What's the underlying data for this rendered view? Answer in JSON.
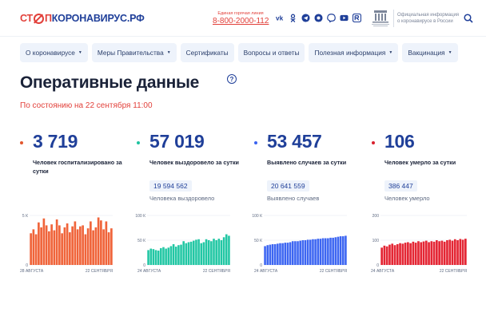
{
  "header": {
    "logo": {
      "part1": "СТ",
      "part2": "П",
      "part3": "КОРОНАВИРУС.РФ"
    },
    "hotline_label": "Единая горячая линия",
    "hotline_number": "8-800-2000-112",
    "socials": [
      "vk-icon",
      "odnoklassniki-icon",
      "telegram-icon",
      "vk-clips-icon",
      "viber-icon",
      "youtube-icon",
      "rutube-icon"
    ],
    "official_text": "Официальная информация о коронавирусе в России"
  },
  "nav": [
    {
      "label": "О коронавирусе",
      "dropdown": true
    },
    {
      "label": "Меры Правительства",
      "dropdown": true
    },
    {
      "label": "Сертификаты",
      "dropdown": false
    },
    {
      "label": "Вопросы и ответы",
      "dropdown": false
    },
    {
      "label": "Полезная информация",
      "dropdown": true
    },
    {
      "label": "Вакцинация",
      "dropdown": true
    }
  ],
  "page": {
    "title": "Оперативные данные",
    "as_of": "По состоянию на 22 сентября 11:00"
  },
  "stats": [
    {
      "value": "3 719",
      "desc": "Человек госпитализировано за сутки",
      "total": "",
      "total_label": "",
      "color": "#e2572e"
    },
    {
      "value": "57 019",
      "desc": "Человек выздоровело за сутки",
      "total": "19 594 562",
      "total_label": "Человека выздоровело",
      "color": "#1ec3a0"
    },
    {
      "value": "53 457",
      "desc": "Выявлено случаев за сутки",
      "total": "20 641 559",
      "total_label": "Выявлено случаев",
      "color": "#3a63f0"
    },
    {
      "value": "106",
      "desc": "Человек умерло за сутки",
      "total": "386 447",
      "total_label": "Человек умерло",
      "color": "#d8202e"
    }
  ],
  "chart_data": [
    {
      "type": "bar",
      "series": [
        {
          "values": [
            3.2,
            3.6,
            3.1,
            4.3,
            3.8,
            4.7,
            4.0,
            3.4,
            4.1,
            3.5,
            4.6,
            4.0,
            3.2,
            3.8,
            4.2,
            3.3,
            3.9,
            4.4,
            3.6,
            3.9,
            4.0,
            3.1,
            3.7,
            4.4,
            3.5,
            3.8,
            4.8,
            4.5,
            3.6,
            4.4,
            3.3,
            3.7
          ]
        }
      ],
      "ylim": [
        0,
        5
      ],
      "yticks": [
        "0",
        "5 К"
      ],
      "x_start": "28 АВГУСТА",
      "x_end": "22 СЕНТЯБРЯ",
      "color": "#f0643a"
    },
    {
      "type": "bar",
      "series": [
        {
          "values": [
            30,
            33,
            32,
            30,
            29,
            34,
            36,
            33,
            35,
            38,
            42,
            37,
            40,
            41,
            48,
            44,
            46,
            47,
            49,
            51,
            52,
            44,
            46,
            52,
            50,
            48,
            53,
            50,
            53,
            50,
            56,
            62,
            59
          ]
        }
      ],
      "ylim": [
        0,
        100
      ],
      "yticks": [
        "0",
        "50 К",
        "100 К"
      ],
      "x_start": "24 АВГУСТА",
      "x_end": "22 СЕНТЯБРЯ",
      "color": "#22c7a4"
    },
    {
      "type": "bar",
      "series": [
        {
          "values": [
            38,
            40,
            41,
            42,
            42,
            43,
            44,
            44,
            45,
            45,
            46,
            48,
            48,
            48,
            49,
            50,
            50,
            51,
            51,
            52,
            52,
            53,
            53,
            54,
            54,
            54,
            55,
            55,
            56,
            57,
            58,
            58,
            59
          ]
        }
      ],
      "ylim": [
        0,
        100
      ],
      "yticks": [
        "0",
        "50 К",
        "100 К"
      ],
      "x_start": "24 АВГУСТА",
      "x_end": "22 СЕНТЯБРЯ",
      "color": "#3d66f2"
    },
    {
      "type": "bar",
      "series": [
        {
          "values": [
            70,
            78,
            75,
            82,
            86,
            80,
            84,
            88,
            86,
            90,
            92,
            88,
            94,
            90,
            96,
            92,
            95,
            98,
            92,
            96,
            94,
            100,
            96,
            98,
            94,
            100,
            102,
            98,
            104,
            100,
            105,
            102,
            106
          ]
        }
      ],
      "ylim": [
        0,
        200
      ],
      "yticks": [
        "0",
        "100",
        "200"
      ],
      "x_start": "24 АВГУСТА",
      "x_end": "22 СЕНТЯБРЯ",
      "color": "#e42634"
    }
  ]
}
